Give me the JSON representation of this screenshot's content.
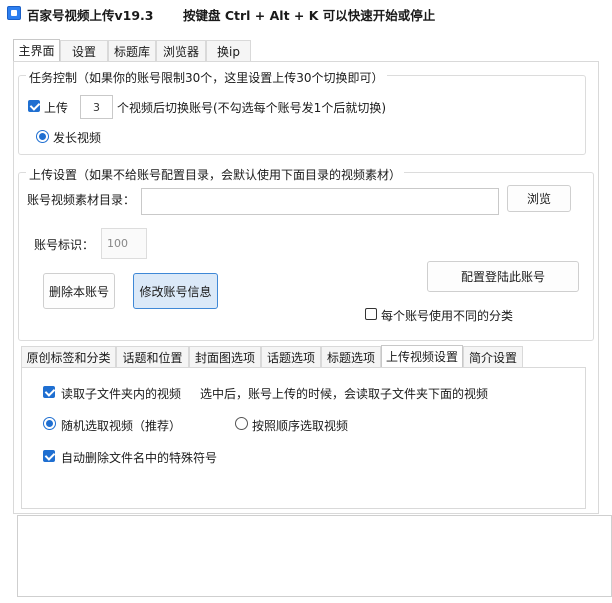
{
  "window": {
    "app_title": "百家号视频上传v19.3",
    "hotkey_hint": "按键盘 Ctrl + Alt + K 可以快速开始或停止"
  },
  "main_tabs": [
    {
      "label": "主界面",
      "active": true
    },
    {
      "label": "设置",
      "active": false
    },
    {
      "label": "标题库",
      "active": false
    },
    {
      "label": "浏览器",
      "active": false
    },
    {
      "label": "换ip",
      "active": false
    }
  ],
  "task_control": {
    "legend": "任务控制（如果你的账号限制30个，这里设置上传30个切换即可）",
    "upload_checkbox_label": "上传",
    "upload_checked": true,
    "upload_count": "3",
    "switch_suffix": "个视频后切换账号(不勾选每个账号发1个后就切换)",
    "long_video_label": "发长视频",
    "long_video_selected": true
  },
  "upload_settings": {
    "legend": "上传设置（如果不给账号配置目录，会默认使用下面目录的视频素材）",
    "dir_label": "账号视频素材目录：",
    "dir_value": "",
    "browse_label": "浏览",
    "id_label": "账号标识：",
    "id_value": "100",
    "delete_label": "删除本账号",
    "modify_label": "修改账号信息",
    "config_label": "配置登陆此账号",
    "diff_category_label": "每个账号使用不同的分类",
    "diff_category_checked": false
  },
  "sub_tabs": [
    {
      "label": "原创标签和分类",
      "active": false
    },
    {
      "label": "话题和位置",
      "active": false
    },
    {
      "label": "封面图选项",
      "active": false
    },
    {
      "label": "话题选项",
      "active": false
    },
    {
      "label": "标题选项",
      "active": false
    },
    {
      "label": "上传视频设置",
      "active": true
    },
    {
      "label": "简介设置",
      "active": false
    }
  ],
  "upload_video_settings": {
    "read_subfolder_label": "读取子文件夹内的视频",
    "read_subfolder_checked": true,
    "read_subfolder_hint": "选中后，账号上传的时候，会读取子文件夹下面的视频",
    "random_label": "随机选取视频（推荐）",
    "random_selected": true,
    "sequential_label": "按照顺序选取视频",
    "sequential_selected": false,
    "auto_delete_label": "自动删除文件名中的特殊符号",
    "auto_delete_checked": true
  },
  "log": {
    "text": ""
  }
}
